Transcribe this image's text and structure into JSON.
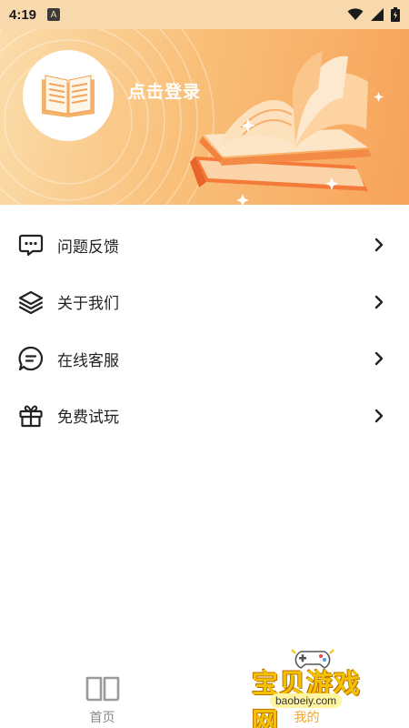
{
  "status_bar": {
    "time": "4:19",
    "app_icon_letter": "A"
  },
  "header": {
    "login_label": "点击登录",
    "avatar_icon": "open-book-icon"
  },
  "menu": {
    "items": [
      {
        "label": "问题反馈",
        "icon": "chat-dots-icon"
      },
      {
        "label": "关于我们",
        "icon": "layers-icon"
      },
      {
        "label": "在线客服",
        "icon": "message-lines-icon"
      },
      {
        "label": "免费试玩",
        "icon": "gift-icon"
      }
    ]
  },
  "tabbar": {
    "home_label": "首页",
    "mine_label": "我的"
  },
  "watermark": {
    "text": "宝贝游戏网",
    "url": "baobeiy.com"
  },
  "colors": {
    "accent": "#f5a623",
    "header_start": "#fbdcaa",
    "header_end": "#f7a35a"
  }
}
